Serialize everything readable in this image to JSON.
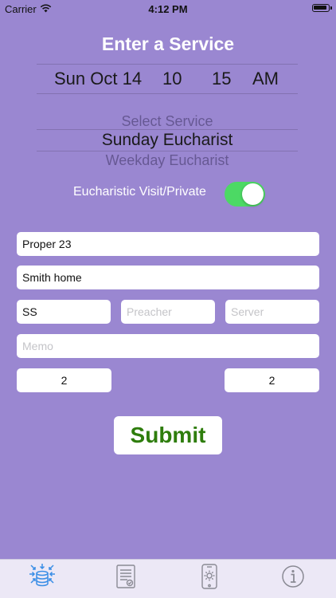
{
  "status_bar": {
    "carrier": "Carrier",
    "time": "4:12 PM"
  },
  "title": "Enter a Service",
  "date_picker": {
    "date": "Sun Oct 14",
    "hour": "10",
    "minute": "15",
    "ampm": "AM"
  },
  "service_picker": {
    "above": "Select Service",
    "selected": "Sunday Eucharist",
    "below": "Weekday Eucharist"
  },
  "toggle": {
    "label": "Eucharistic Visit/Private",
    "on": true
  },
  "fields": {
    "proper": "Proper 23",
    "location": "Smith home",
    "celebrant": "SS",
    "preacher_placeholder": "Preacher",
    "server_placeholder": "Server",
    "memo_placeholder": "Memo",
    "count_left": "2",
    "count_right": "2"
  },
  "submit_label": "Submit",
  "colors": {
    "background": "#9a87d1",
    "submit_text": "#2e7d0c",
    "toggle_on": "#4cd964",
    "tab_active": "#3a8ee6",
    "tab_inactive": "#8a8a94"
  },
  "tabs": [
    {
      "icon": "database-sync-icon",
      "active": true
    },
    {
      "icon": "checklist-document-icon",
      "active": false
    },
    {
      "icon": "phone-settings-icon",
      "active": false
    },
    {
      "icon": "info-icon",
      "active": false
    }
  ]
}
